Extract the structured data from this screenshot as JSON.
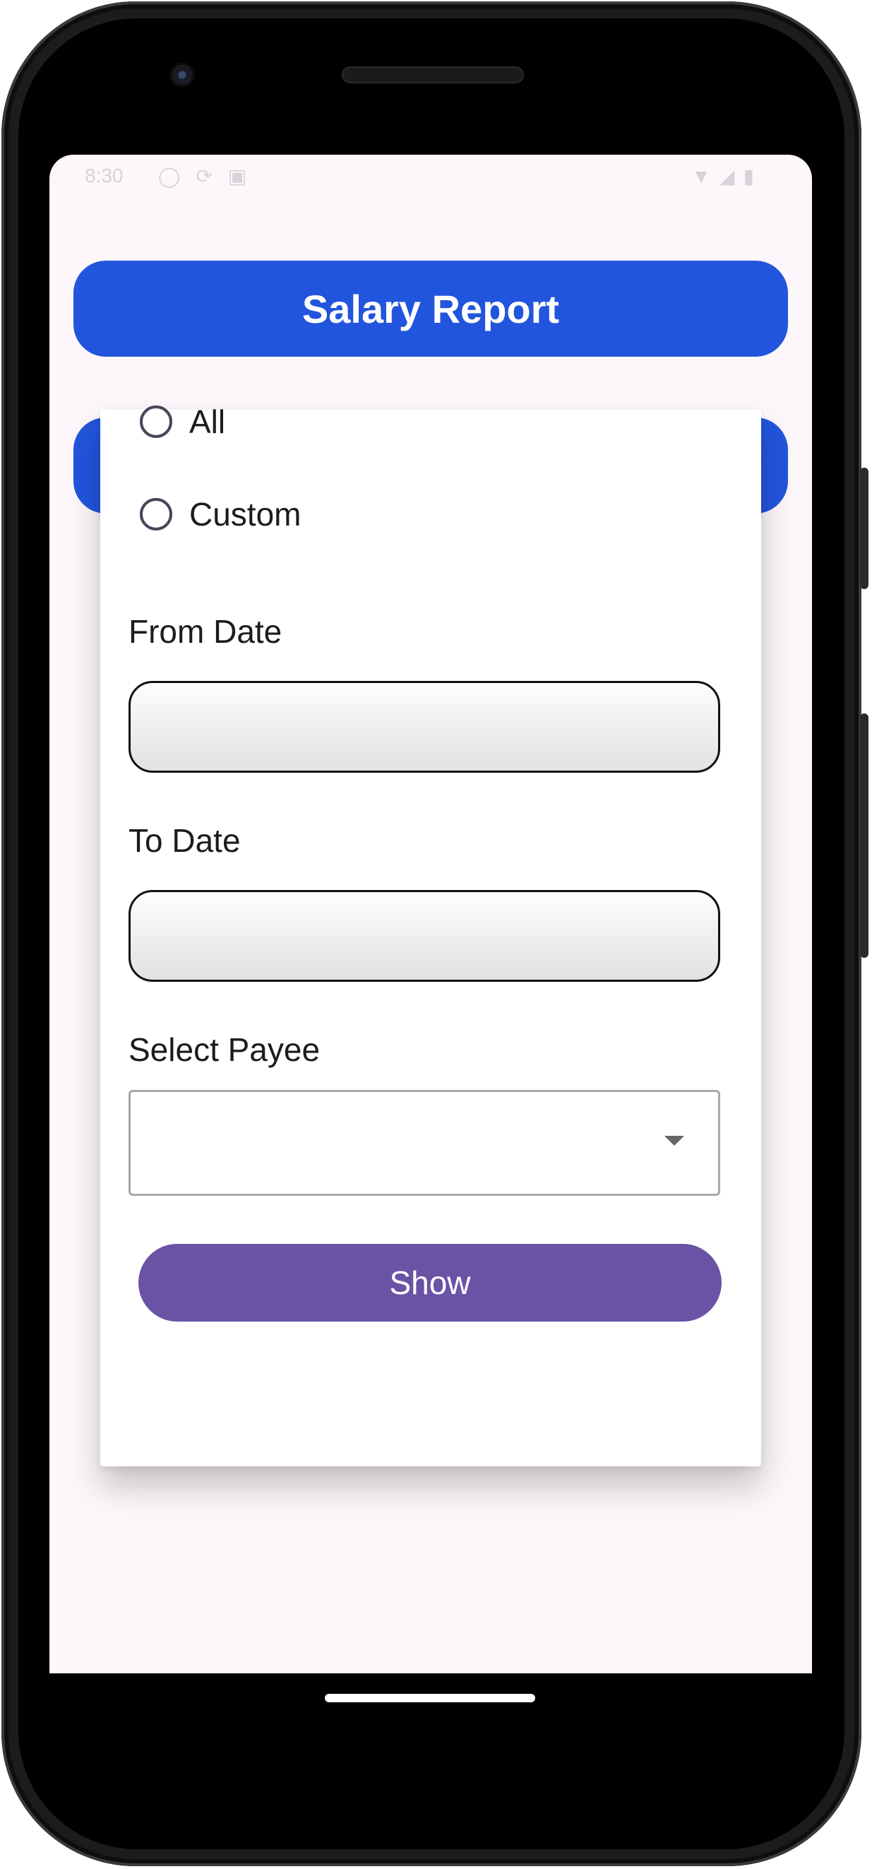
{
  "status_bar": {
    "time": "8:30",
    "left_icons": [
      "shield-icon",
      "sync-icon",
      "sim-icon"
    ],
    "right_icons": [
      "wifi-icon",
      "signal-icon",
      "battery-icon"
    ]
  },
  "header": {
    "title_button_label": "Salary Report"
  },
  "dialog": {
    "radio_options": [
      {
        "label": "All",
        "selected": false
      },
      {
        "label": "Custom",
        "selected": false
      }
    ],
    "from_date": {
      "label": "From Date",
      "value": ""
    },
    "to_date": {
      "label": "To Date",
      "value": ""
    },
    "payee": {
      "label": "Select Payee",
      "selected": ""
    },
    "show_button_label": "Show"
  },
  "colors": {
    "primary_blue": "#2255DD",
    "show_purple": "#6A52A5",
    "screen_background": "#FDF7FB"
  }
}
